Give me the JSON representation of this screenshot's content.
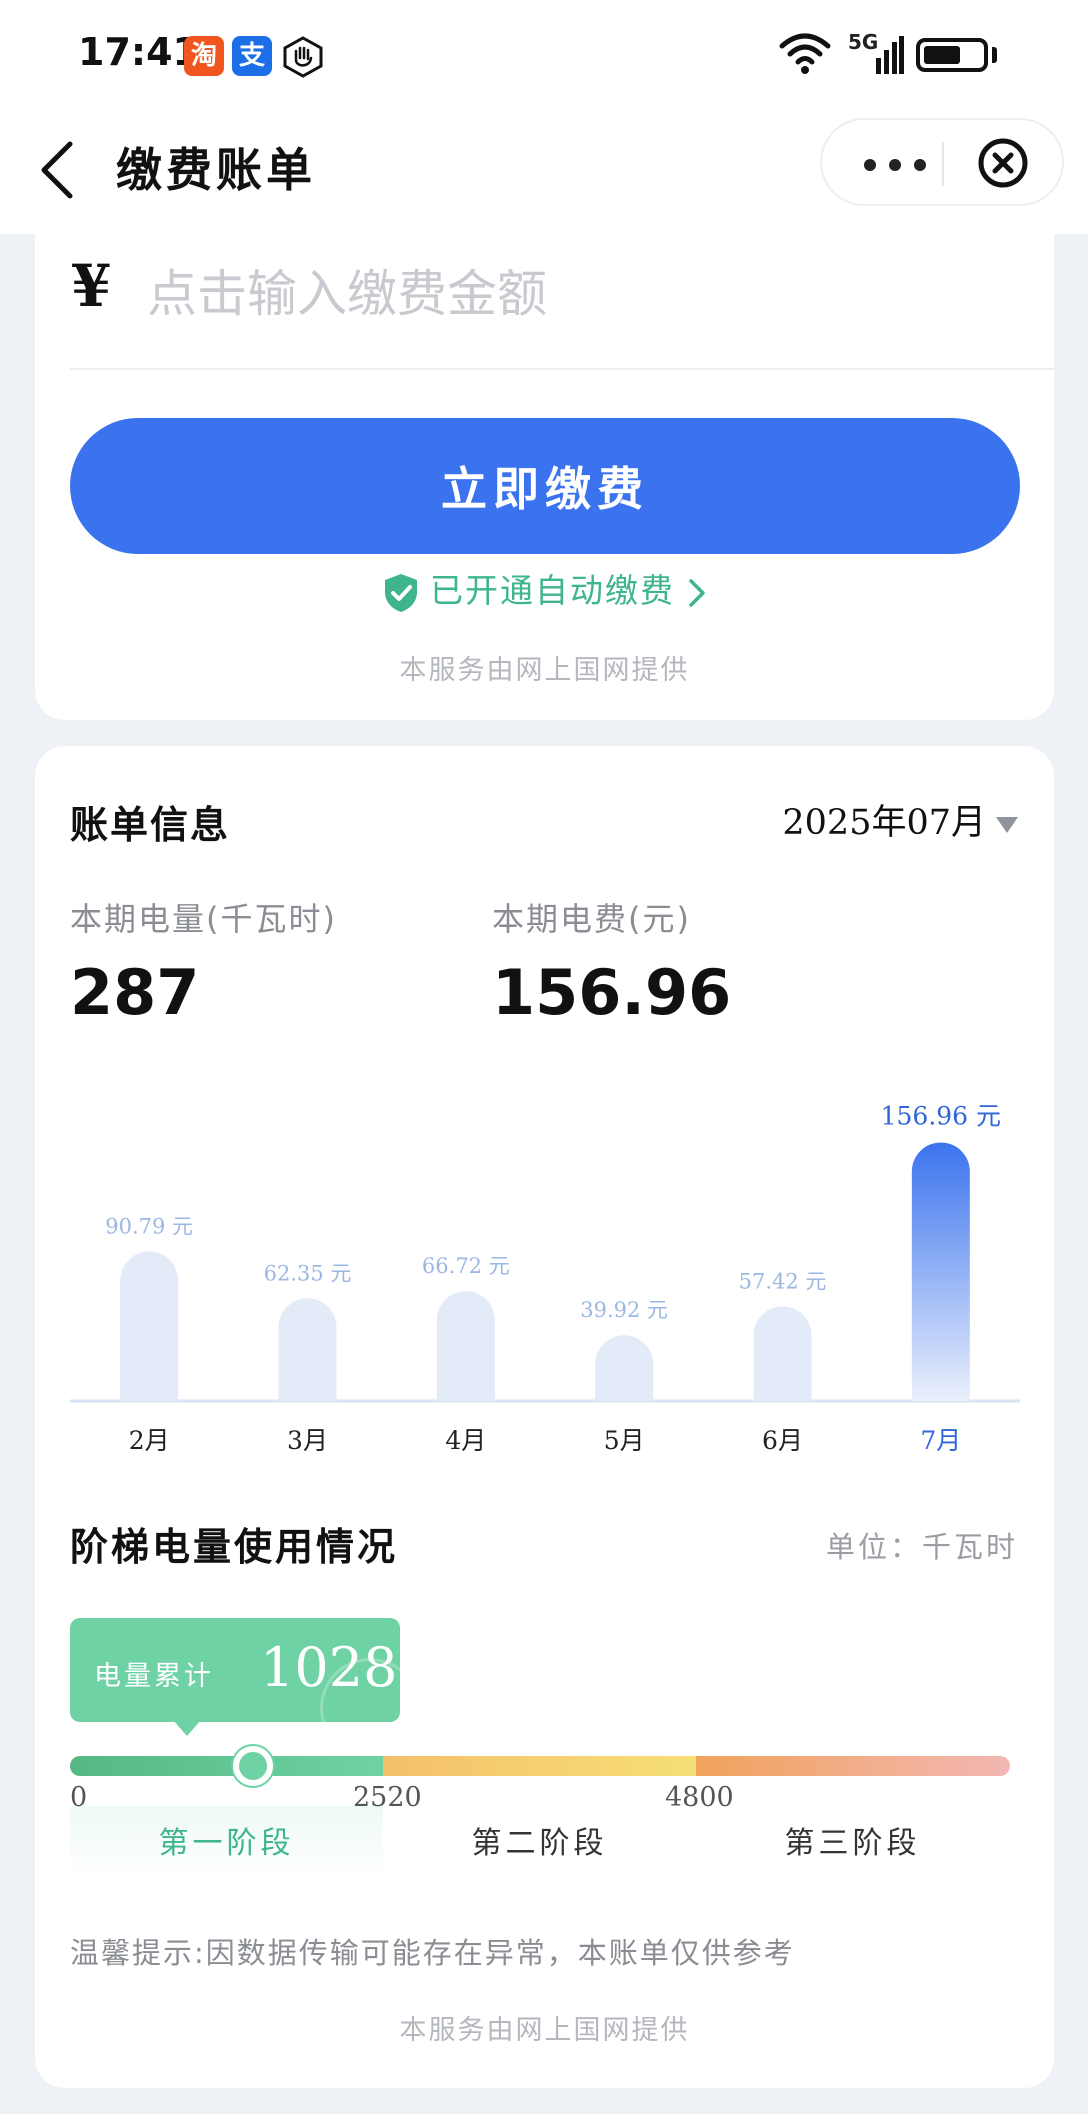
{
  "status_bar": {
    "time": "17:41",
    "app_icons": [
      {
        "name": "taobao-icon",
        "glyph": "淘"
      },
      {
        "name": "alipay-icon",
        "glyph": "支"
      }
    ],
    "network": "5G",
    "battery_level": 0.5
  },
  "nav": {
    "title": "缴费账单"
  },
  "payment": {
    "currency_symbol": "¥",
    "amount_placeholder": "点击输入缴费金额",
    "pay_button": "立即缴费",
    "autopay_text": "已开通自动缴费",
    "provider": "本服务由网上国网提供"
  },
  "bill": {
    "title": "账单信息",
    "selected_month": "2025年07月",
    "usage_label": "本期电量(千瓦时)",
    "usage_value": "287",
    "fee_label": "本期电费(元)",
    "fee_value": "156.96"
  },
  "chart_data": {
    "type": "bar",
    "categories": [
      "2月",
      "3月",
      "4月",
      "5月",
      "6月",
      "7月"
    ],
    "values": [
      90.79,
      62.35,
      66.72,
      39.92,
      57.42,
      156.96
    ],
    "value_labels": [
      "90.79 元",
      "62.35 元",
      "66.72 元",
      "39.92 元",
      "57.42 元",
      "156.96 元"
    ],
    "highlight_index": 5,
    "unit": "元",
    "ylim": [
      0,
      170
    ],
    "colors": {
      "normal": "#e3ebf8",
      "highlight": "#3b73ee",
      "normal_label": "#9bb7e3",
      "highlight_label": "#2f66d8"
    }
  },
  "tier": {
    "title": "阶梯电量使用情况",
    "unit": "单位：千瓦时",
    "cumulative_label": "电量累计",
    "cumulative_value": "1028",
    "ticks": [
      "0",
      "2520",
      "4800"
    ],
    "stages": [
      "第一阶段",
      "第二阶段",
      "第三阶段"
    ],
    "notice": "温馨提示:因数据传输可能存在异常，本账单仅供参考",
    "provider": "本服务由网上国网提供"
  }
}
